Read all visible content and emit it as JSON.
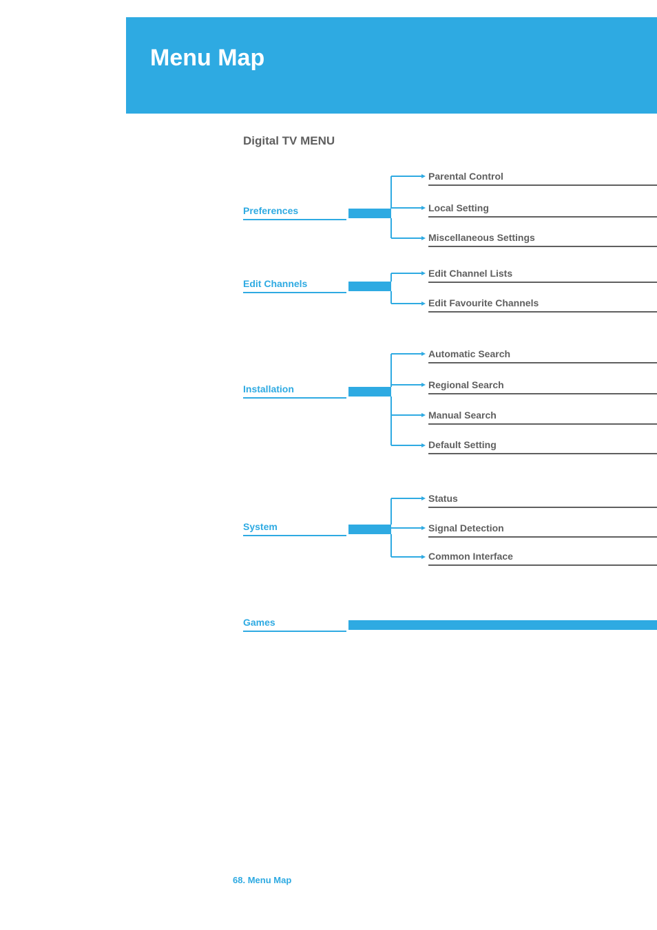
{
  "banner": {
    "title": "Menu Map"
  },
  "section_title": "Digital TV MENU",
  "categories": {
    "preferences": {
      "label": "Preferences",
      "items": [
        "Parental Control",
        "Local Setting",
        "Miscellaneous Settings"
      ]
    },
    "edit_channels": {
      "label": "Edit Channels",
      "items": [
        "Edit Channel Lists",
        "Edit Favourite Channels"
      ]
    },
    "installation": {
      "label": "Installation",
      "items": [
        "Automatic Search",
        "Regional Search",
        "Manual Search",
        "Default Setting"
      ]
    },
    "system": {
      "label": "System",
      "items": [
        "Status",
        "Signal Detection",
        "Common Interface"
      ]
    },
    "games": {
      "label": "Games",
      "items": []
    }
  },
  "footer": {
    "page_number": "68.",
    "label": "Menu Map"
  }
}
